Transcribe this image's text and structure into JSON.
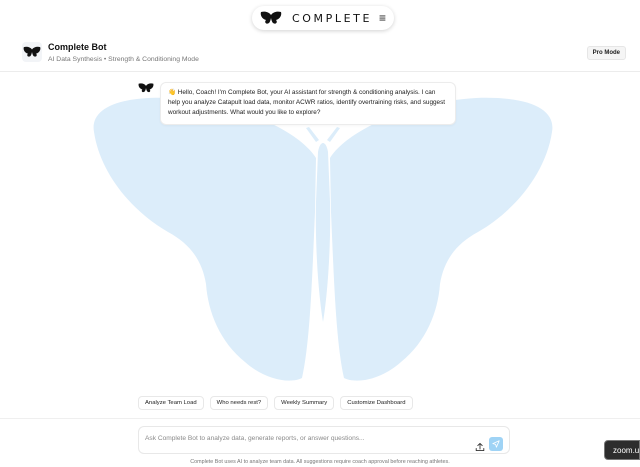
{
  "brand": {
    "logo_text": "COMPLETE",
    "menu_icon": "hamburger-menu-icon"
  },
  "header": {
    "bot_name": "Complete Bot",
    "subtitle": "AI Data Synthesis • Strength & Conditioning Mode",
    "mode_badge": "Pro Mode"
  },
  "conversation": {
    "messages": [
      {
        "sender": "bot",
        "text": "👋 Hello, Coach! I'm Complete Bot, your AI assistant for strength & conditioning analysis. I can help you analyze Catapult load data, monitor ACWR ratios, identify overtraining risks, and suggest workout adjustments. What would you like to explore?"
      }
    ]
  },
  "quick_actions": [
    {
      "label": "Analyze Team Load"
    },
    {
      "label": "Who needs rest?"
    },
    {
      "label": "Weekly Summary"
    },
    {
      "label": "Customize Dashboard"
    }
  ],
  "composer": {
    "placeholder": "Ask Complete Bot to analyze data, generate reports, or answer questions...",
    "value": ""
  },
  "footer_note": "Complete Bot uses AI to analyze team data. All suggestions require coach approval before reaching athletes.",
  "overlay": {
    "zoom_label": "zoom.us"
  },
  "colors": {
    "accent": "#9fd3f5",
    "watermark": "#dcedfa"
  }
}
